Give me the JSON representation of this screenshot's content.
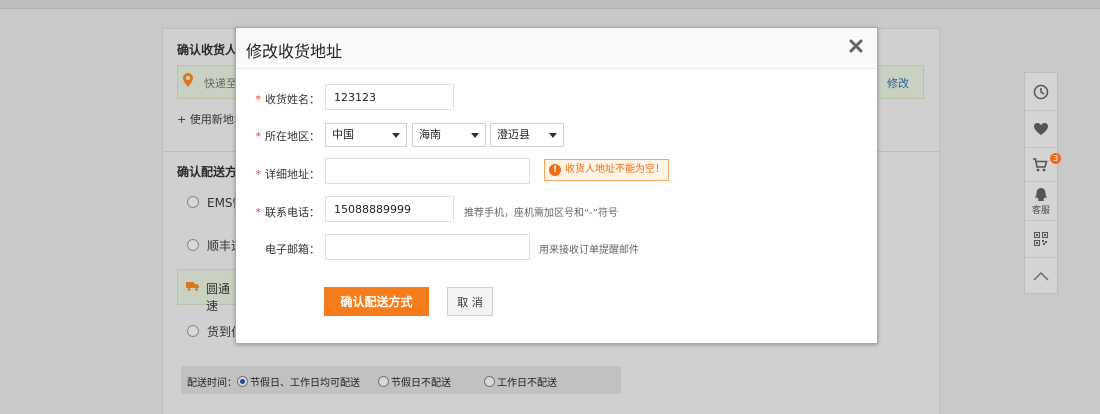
{
  "background": {
    "confirm_address_title": "确认收货人信",
    "address_text": "快递至",
    "modify_link": "修改",
    "new_address_link": "+ 使用新地址",
    "delivery_title": "确认配送方式",
    "options": [
      "EMS快",
      "顺丰速",
      "圆通速",
      "货到付"
    ],
    "selected_option_index": 2,
    "delivery_time_label": "配送时间：",
    "delivery_time_options": [
      "节假日、工作日均可配送",
      "节假日不配送",
      "工作日不配送"
    ],
    "delivery_time_selected": 0
  },
  "sidebar": {
    "items": [
      {
        "icon": "clock-icon"
      },
      {
        "icon": "heart-icon"
      },
      {
        "icon": "cart-icon",
        "badge": "3"
      },
      {
        "icon": "qq-icon",
        "label": "客服"
      },
      {
        "icon": "qrcode-icon"
      },
      {
        "icon": "chevron-up-icon"
      }
    ]
  },
  "modal": {
    "title": "修改收货地址",
    "close_icon": "close-icon",
    "fields": {
      "name": {
        "label": "收货姓名：",
        "required": true,
        "value": "123123"
      },
      "region": {
        "label": "所在地区：",
        "required": true,
        "country": "中国",
        "province": "海南",
        "county": "澄迈县"
      },
      "address": {
        "label": "详细地址：",
        "required": true,
        "value": "",
        "error": "收货人地址不能为空！"
      },
      "phone": {
        "label": "联系电话：",
        "required": true,
        "value": "15088889999",
        "hint": "推荐手机，座机需加区号和“-”符号"
      },
      "email": {
        "label": "电子邮箱：",
        "required": false,
        "value": "",
        "hint": "用来接收订单提醒邮件"
      }
    },
    "confirm_button": "确认配送方式",
    "cancel_button": "取 消",
    "required_mark": "*"
  },
  "colors": {
    "accent_orange": "#f57b1b",
    "error_red": "#e4393c",
    "link_blue": "#2b5f95"
  }
}
